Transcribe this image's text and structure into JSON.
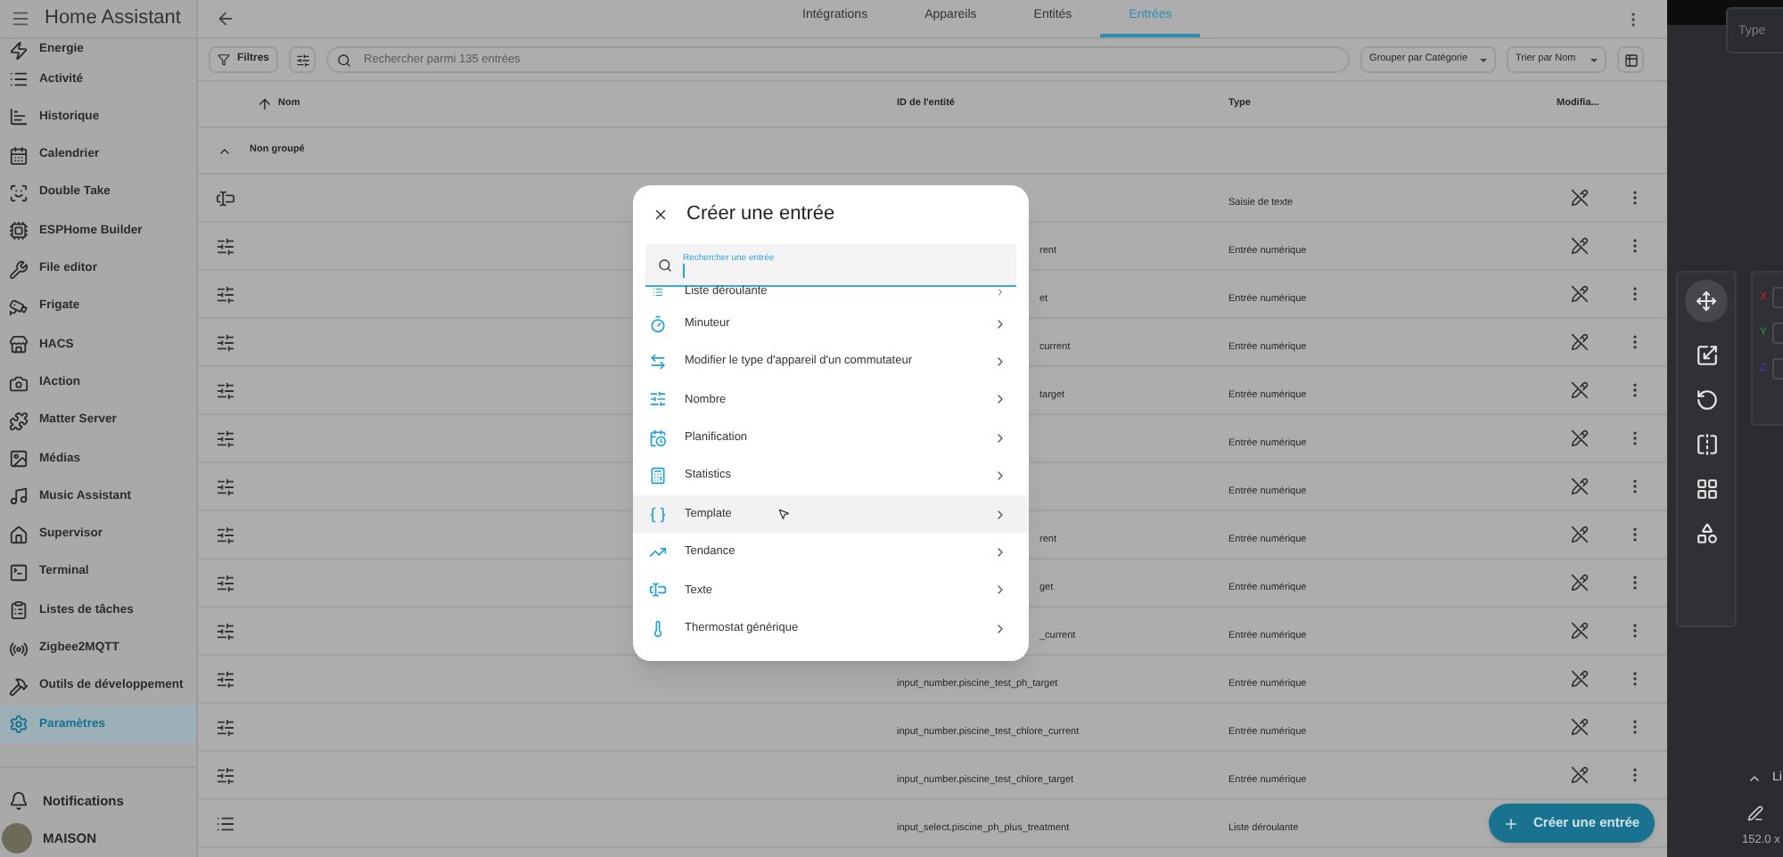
{
  "sidebar": {
    "title": "Home Assistant",
    "items": [
      {
        "label": "Energie",
        "selected": false
      },
      {
        "label": "Activité",
        "selected": false
      },
      {
        "label": "Historique",
        "selected": false
      },
      {
        "label": "Calendrier",
        "selected": false
      },
      {
        "label": "Double Take",
        "selected": false
      },
      {
        "label": "ESPHome Builder",
        "selected": false
      },
      {
        "label": "File editor",
        "selected": false
      },
      {
        "label": "Frigate",
        "selected": false
      },
      {
        "label": "HACS",
        "selected": false
      },
      {
        "label": "IAction",
        "selected": false
      },
      {
        "label": "Matter Server",
        "selected": false
      },
      {
        "label": "Médias",
        "selected": false
      },
      {
        "label": "Music Assistant",
        "selected": false
      },
      {
        "label": "Supervisor",
        "selected": false
      },
      {
        "label": "Terminal",
        "selected": false
      },
      {
        "label": "Listes de tâches",
        "selected": false
      },
      {
        "label": "Zigbee2MQTT",
        "selected": false
      },
      {
        "label": "Outils de développement",
        "selected": false
      },
      {
        "label": "Paramètres",
        "selected": true
      }
    ],
    "notifications": "Notifications",
    "user": "MAISON"
  },
  "tabs": [
    {
      "label": "Intégrations",
      "selected": false
    },
    {
      "label": "Appareils",
      "selected": false
    },
    {
      "label": "Entités",
      "selected": false
    },
    {
      "label": "Entrées",
      "selected": true
    }
  ],
  "toolbar": {
    "filters": "Filtres",
    "search_placeholder": "Rechercher parmi 135 entrées",
    "group_by": "Grouper par Catégorie",
    "sort_by": "Trier par Nom"
  },
  "table": {
    "columns": [
      "Nom",
      "ID de l'entité",
      "Type",
      "Modifia..."
    ],
    "group": "Non groupé",
    "rows": [
      {
        "kind": "text",
        "entity_id": "",
        "type": "Saisie de texte"
      },
      {
        "kind": "number",
        "entity_id": "rent",
        "type": "Entrée numérique",
        "covered": true
      },
      {
        "kind": "number",
        "entity_id": "et",
        "type": "Entrée numérique",
        "covered": true
      },
      {
        "kind": "number",
        "entity_id": "current",
        "type": "Entrée numérique",
        "covered": true
      },
      {
        "kind": "number",
        "entity_id": "target",
        "type": "Entrée numérique",
        "covered": true
      },
      {
        "kind": "number",
        "entity_id": "",
        "type": "Entrée numérique"
      },
      {
        "kind": "number",
        "entity_id": "",
        "type": "Entrée numérique"
      },
      {
        "kind": "number",
        "entity_id": "rent",
        "type": "Entrée numérique",
        "covered": true
      },
      {
        "kind": "number",
        "entity_id": "get",
        "type": "Entrée numérique",
        "covered": true
      },
      {
        "kind": "number",
        "entity_id": "_current",
        "type": "Entrée numérique",
        "covered": true
      },
      {
        "kind": "number",
        "entity_id": "input_number.piscine_test_ph_target",
        "type": "Entrée numérique"
      },
      {
        "kind": "number",
        "entity_id": "input_number.piscine_test_chlore_current",
        "type": "Entrée numérique"
      },
      {
        "kind": "number",
        "entity_id": "input_number.piscine_test_chlore_target",
        "type": "Entrée numérique"
      },
      {
        "kind": "select",
        "entity_id": "input_select.piscine_ph_plus_treatment",
        "type": "Liste déroulante"
      }
    ]
  },
  "fab": "Créer une entrée",
  "dialog": {
    "title": "Créer une entrée",
    "search_label": "Rechercher une entrée",
    "items": [
      {
        "label": "Liste déroulante",
        "selected": false
      },
      {
        "label": "Minuteur",
        "selected": false
      },
      {
        "label": "Modifier le type d'appareil d'un commutateur",
        "selected": false
      },
      {
        "label": "Nombre",
        "selected": false
      },
      {
        "label": "Planification",
        "selected": false
      },
      {
        "label": "Statistics",
        "selected": false
      },
      {
        "label": "Template",
        "selected": true
      },
      {
        "label": "Tendance",
        "selected": false
      },
      {
        "label": "Texte",
        "selected": false
      },
      {
        "label": "Thermostat générique",
        "selected": false
      }
    ]
  },
  "side_panel": {
    "type_field": "Type",
    "axes": [
      {
        "label": "X",
        "color": "#c62828"
      },
      {
        "label": "Y",
        "color": "#2e9e3a"
      },
      {
        "label": "Z",
        "color": "#3b3bc4"
      }
    ],
    "section": "Li",
    "size": "152.0 x"
  }
}
